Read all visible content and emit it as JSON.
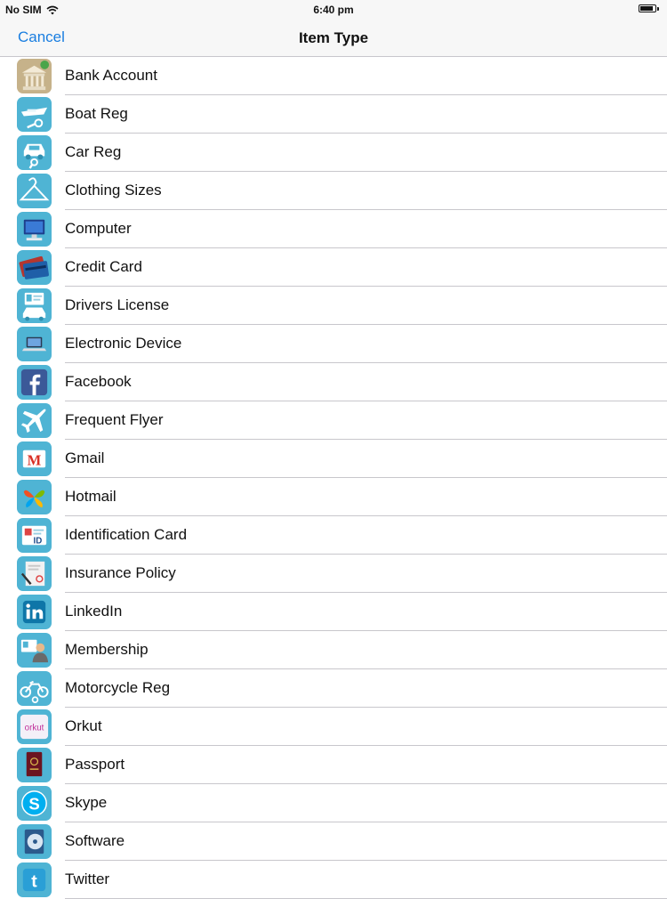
{
  "status_bar": {
    "carrier": "No SIM",
    "time": "6:40 pm",
    "battery_level": 0.9
  },
  "nav": {
    "cancel_label": "Cancel",
    "title": "Item Type"
  },
  "items": [
    {
      "label": "Bank Account",
      "icon": "bank-icon"
    },
    {
      "label": "Boat Reg",
      "icon": "boat-icon"
    },
    {
      "label": "Car Reg",
      "icon": "car-icon"
    },
    {
      "label": "Clothing Sizes",
      "icon": "hanger-icon"
    },
    {
      "label": "Computer",
      "icon": "computer-icon"
    },
    {
      "label": "Credit Card",
      "icon": "credit-card-icon"
    },
    {
      "label": "Drivers License",
      "icon": "drivers-license-icon"
    },
    {
      "label": "Electronic Device",
      "icon": "laptop-icon"
    },
    {
      "label": "Facebook",
      "icon": "facebook-icon"
    },
    {
      "label": "Frequent Flyer",
      "icon": "airplane-icon"
    },
    {
      "label": "Gmail",
      "icon": "gmail-icon"
    },
    {
      "label": "Hotmail",
      "icon": "hotmail-icon"
    },
    {
      "label": "Identification Card",
      "icon": "id-card-icon"
    },
    {
      "label": "Insurance Policy",
      "icon": "insurance-policy-icon"
    },
    {
      "label": "LinkedIn",
      "icon": "linkedin-icon"
    },
    {
      "label": "Membership",
      "icon": "membership-icon"
    },
    {
      "label": "Motorcycle Reg",
      "icon": "motorcycle-icon"
    },
    {
      "label": "Orkut",
      "icon": "orkut-icon"
    },
    {
      "label": "Passport",
      "icon": "passport-icon"
    },
    {
      "label": "Skype",
      "icon": "skype-icon"
    },
    {
      "label": "Software",
      "icon": "software-icon"
    },
    {
      "label": "Twitter",
      "icon": "twitter-icon"
    }
  ],
  "icon_text": {
    "id": "ID",
    "gmail": "M",
    "orkut": "orkut",
    "skype": "S",
    "twitter": "t"
  },
  "colors": {
    "accent": "#1a7ee0",
    "icon_tile": "#4fb4d4",
    "separator": "#c8c7cc"
  }
}
